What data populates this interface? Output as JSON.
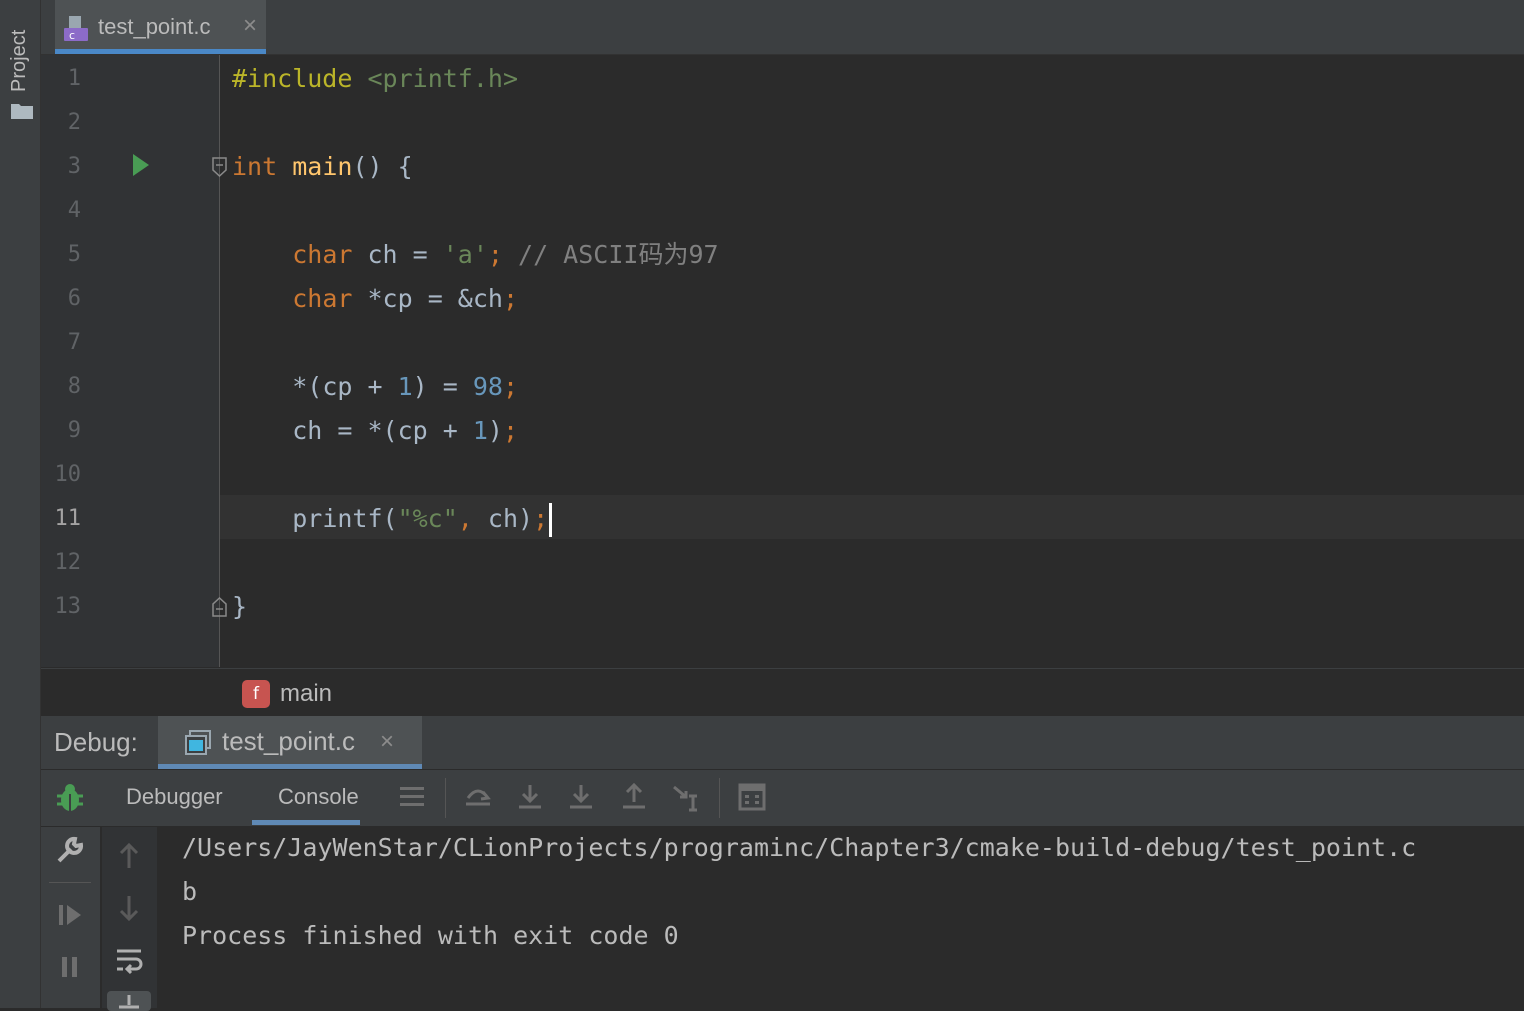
{
  "left_strip": {
    "project_label": "Project"
  },
  "editor_tabs": [
    {
      "label": "test_point.c",
      "close": "×"
    }
  ],
  "gutter": {
    "line_numbers": [
      "1",
      "2",
      "3",
      "4",
      "5",
      "6",
      "7",
      "8",
      "9",
      "10",
      "11",
      "12",
      "13"
    ],
    "current_line": "11"
  },
  "code": {
    "l1": {
      "directive": "#include",
      "header": "<printf.h>"
    },
    "l3": {
      "type": "int",
      "name": "main",
      "rest": "() {"
    },
    "l5": {
      "type": "char",
      "decl": " ch = ",
      "lit": "'a'",
      "semi": ";",
      "comment": "// ASCII码为97"
    },
    "l6": {
      "type": "char",
      "decl": " *cp = &ch",
      "semi": ";"
    },
    "l8": {
      "a": "*(cp + ",
      "n1": "1",
      "b": ") = ",
      "n2": "98",
      "semi": ";"
    },
    "l9": {
      "a": "ch = *(cp + ",
      "n1": "1",
      "b": ")",
      "semi": ";"
    },
    "l11": {
      "a": "printf(",
      "str": "\"%c\"",
      "comma": ",",
      "b": " ch)",
      "semi": ";"
    },
    "l13": {
      "brace": "}"
    }
  },
  "breadcrumb": {
    "icon": "f",
    "label": "main"
  },
  "debug": {
    "title": "Debug:",
    "tab_label": "test_point.c",
    "tab_close": "×",
    "sub_tabs": {
      "debugger": "Debugger",
      "console": "Console"
    }
  },
  "console": {
    "lines": [
      "/Users/JayWenStar/CLionProjects/programinc/Chapter3/cmake-build-debug/test_point.c",
      "b",
      "Process finished with exit code 0"
    ]
  },
  "colors": {
    "accent": "#4a88c7",
    "run_green": "#499c54",
    "keyword": "#cc7832",
    "number": "#6897bb",
    "string": "#6a8759"
  }
}
